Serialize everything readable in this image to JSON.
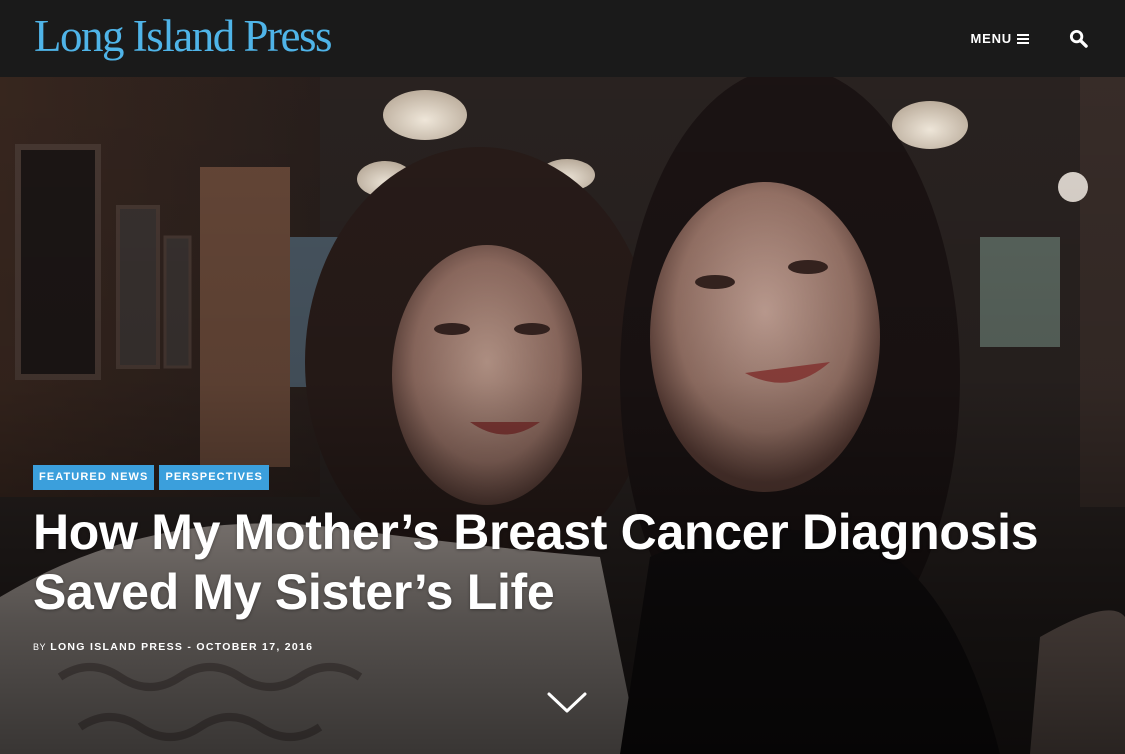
{
  "header": {
    "logo_text": "Long Island Press",
    "menu_label": "MENU",
    "menu_icon": "hamburger-icon",
    "search_icon": "search-icon"
  },
  "colors": {
    "brand_blue": "#4fb4e8",
    "tag_blue": "#3b9fdc",
    "header_bg": "#1a1a1a",
    "text": "#ffffff"
  },
  "article": {
    "tags": [
      "FEATURED NEWS",
      "PERSPECTIVES"
    ],
    "title": "How My Mother’s Breast Cancer Diagnosis Saved My Sister’s Life",
    "byline": {
      "by": "BY",
      "author": "LONG ISLAND PRESS",
      "separator": "-",
      "date": "OCTOBER 17, 2016"
    },
    "scroll_icon": "chevron-down-icon"
  }
}
